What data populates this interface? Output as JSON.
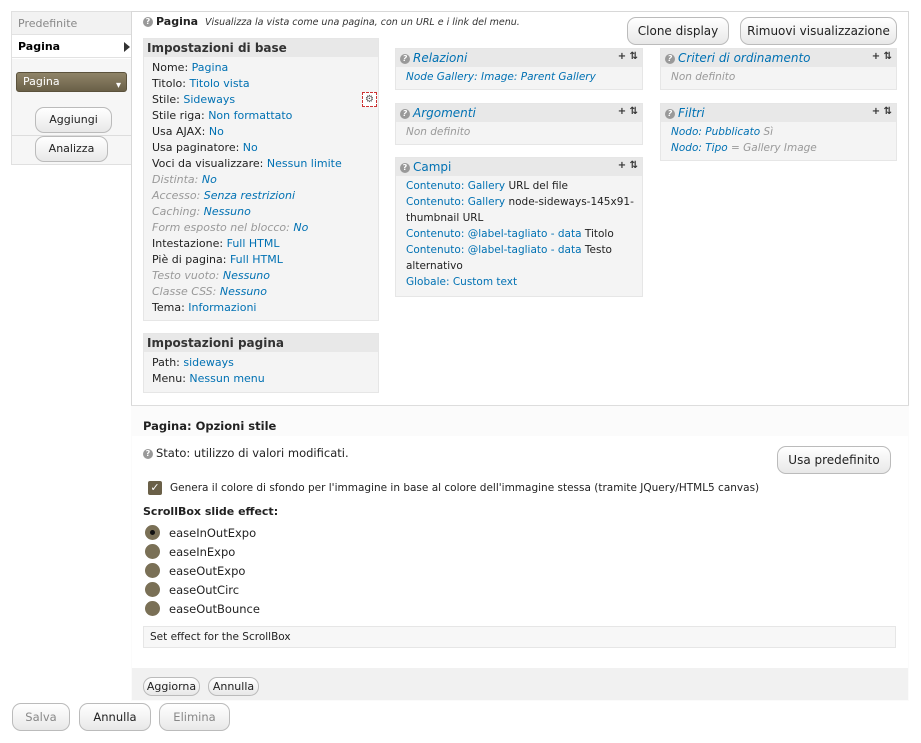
{
  "sidebar": {
    "tab_defaults": "Predefinite",
    "tab_page": "Pagina",
    "select_value": "Pagina",
    "add_label": "Aggiungi",
    "analyze_label": "Analizza"
  },
  "header": {
    "title": "Pagina",
    "description": "Visualizza la vista come una pagina, con un URL e i link del menu.",
    "clone_label": "Clone display",
    "remove_label": "Rimuovi visualizzazione"
  },
  "basic": {
    "title": "Impostazioni di base",
    "rows": [
      {
        "label": "Nome:",
        "value": "Pagina",
        "muted": false
      },
      {
        "label": "Titolo:",
        "value": "Titolo vista",
        "muted": false
      },
      {
        "label": "Stile:",
        "value": "Sideways",
        "muted": false
      },
      {
        "label": "Stile riga:",
        "value": "Non formattato",
        "muted": false
      },
      {
        "label": "Usa AJAX:",
        "value": "No",
        "muted": false
      },
      {
        "label": "Usa paginatore:",
        "value": "No",
        "muted": false
      },
      {
        "label": "Voci da visualizzare:",
        "value": "Nessun limite",
        "muted": false
      },
      {
        "label": "Distinta:",
        "value": "No",
        "muted": true
      },
      {
        "label": "Accesso:",
        "value": "Senza restrizioni",
        "muted": true
      },
      {
        "label": "Caching:",
        "value": "Nessuno",
        "muted": true
      },
      {
        "label": "Form esposto nel blocco:",
        "value": "No",
        "muted": true
      },
      {
        "label": "Intestazione:",
        "value": "Full HTML",
        "muted": false
      },
      {
        "label": "Piè di pagina:",
        "value": "Full HTML",
        "muted": false
      },
      {
        "label": "Testo vuoto:",
        "value": "Nessuno",
        "muted": true
      },
      {
        "label": "Classe CSS:",
        "value": "Nessuno",
        "muted": true
      },
      {
        "label": "Tema:",
        "value": "Informazioni",
        "muted": false
      }
    ]
  },
  "page_settings": {
    "title": "Impostazioni pagina",
    "path_label": "Path:",
    "path_value": "sideways",
    "menu_label": "Menu:",
    "menu_value": "Nessun menu"
  },
  "relations": {
    "title": "Relazioni",
    "item": "Node Gallery: Image: Parent Gallery"
  },
  "arguments": {
    "title": "Argomenti",
    "empty": "Non definito"
  },
  "fields": {
    "title": "Campi",
    "lines": [
      {
        "link": "Contenuto: Gallery",
        "text": " URL del file"
      },
      {
        "link": "Contenuto: Gallery",
        "text": " node-sideways-145x91-"
      },
      {
        "link": "",
        "text": "thumbnail URL"
      },
      {
        "link": "Contenuto: @label-tagliato - data",
        "text": " Titolo"
      },
      {
        "link": "Contenuto: @label-tagliato - data",
        "text": " Testo"
      },
      {
        "link": "",
        "text": "alternativo"
      },
      {
        "link": "Globale: Custom text",
        "text": ""
      }
    ]
  },
  "sort": {
    "title": "Criteri di ordinamento",
    "empty": "Non definito"
  },
  "filters": {
    "title": "Filtri",
    "items": [
      {
        "link": "Nodo: Pubblicato",
        "text": " Sì"
      },
      {
        "link": "Nodo: Tipo",
        "text": " = Gallery Image"
      }
    ]
  },
  "style_options": {
    "title": "Pagina: Opzioni stile",
    "status": "Stato: utilizzo di valori modificati.",
    "default_label": "Usa predefinito",
    "checkbox_label": "Genera il colore di sfondo per l'immagine in base al colore dell'immagine stessa (tramite JQuery/HTML5 canvas)",
    "effect_title": "ScrollBox slide effect:",
    "effects": [
      "easeInOutExpo",
      "easeInExpo",
      "easeOutExpo",
      "easeOutCirc",
      "easeOutBounce"
    ],
    "selected_effect": "easeInOutExpo",
    "effect_description": "Set effect for the ScrollBox",
    "update_label": "Aggiorna",
    "cancel_label": "Annulla"
  },
  "footer": {
    "save_label": "Salva",
    "cancel_label": "Annulla",
    "delete_label": "Elimina"
  },
  "icons": {
    "help": "?",
    "add": "+",
    "rearrange": "⇅",
    "gear": "⚙",
    "check": "✓",
    "chevron": "▾"
  }
}
